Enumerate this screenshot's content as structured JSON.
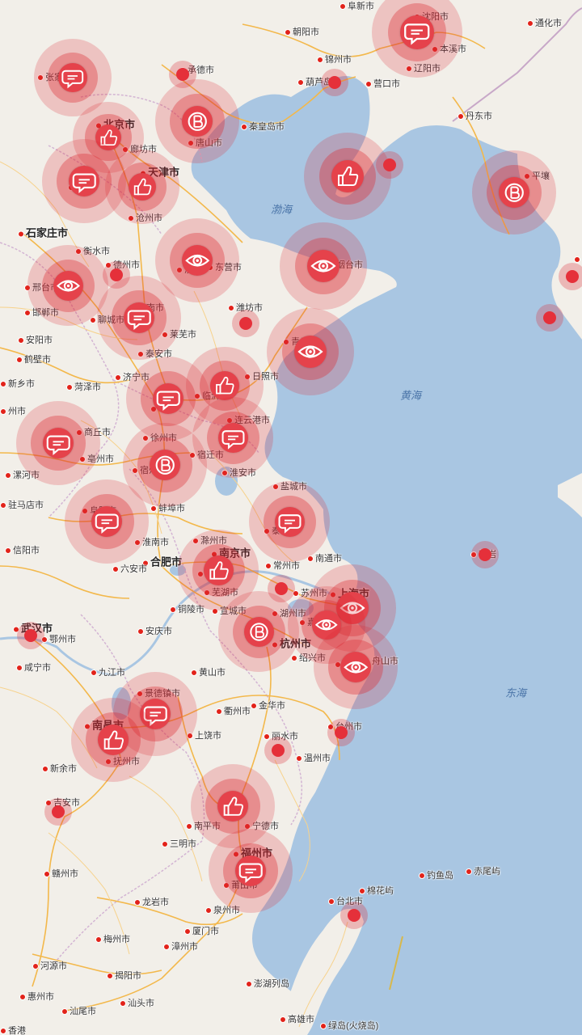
{
  "map": {
    "colors": {
      "land": "#f2efe9",
      "sea": "#a9c6e2",
      "road": "#f3b84b",
      "border": "#c8a8c8",
      "marker": "#e5424b"
    },
    "seas": [
      {
        "name": "渤海"
      },
      {
        "name": "黄海"
      },
      {
        "name": "东海"
      }
    ],
    "cities": [
      {
        "name": "张家口",
        "major": false
      },
      {
        "name": "承德市",
        "major": false
      },
      {
        "name": "朝阳市",
        "major": false
      },
      {
        "name": "阜新市",
        "major": false
      },
      {
        "name": "沈阳市",
        "major": false
      },
      {
        "name": "本溪市",
        "major": false
      },
      {
        "name": "辽阳市",
        "major": false
      },
      {
        "name": "锦州市",
        "major": false
      },
      {
        "name": "葫芦岛",
        "major": false
      },
      {
        "name": "营口市",
        "major": false
      },
      {
        "name": "通化市",
        "major": false
      },
      {
        "name": "丹东市",
        "major": false
      },
      {
        "name": "北京市",
        "major": true
      },
      {
        "name": "廊坊市",
        "major": false
      },
      {
        "name": "唐山市",
        "major": false
      },
      {
        "name": "秦皇岛市",
        "major": false
      },
      {
        "name": "天津市",
        "major": true
      },
      {
        "name": "保",
        "major": false
      },
      {
        "name": "沧州市",
        "major": false
      },
      {
        "name": "平壤",
        "major": false
      },
      {
        "name": "首",
        "major": false
      },
      {
        "name": "石家庄市",
        "major": true
      },
      {
        "name": "衡水市",
        "major": false
      },
      {
        "name": "德州市",
        "major": false
      },
      {
        "name": "滨州",
        "major": false
      },
      {
        "name": "东营市",
        "major": false
      },
      {
        "name": "烟台市",
        "major": false
      },
      {
        "name": "邢台市",
        "major": false
      },
      {
        "name": "邯郸市",
        "major": false
      },
      {
        "name": "聊城市",
        "major": false
      },
      {
        "name": "济南市",
        "major": false
      },
      {
        "name": "潍坊市",
        "major": false
      },
      {
        "name": "莱芜市",
        "major": false
      },
      {
        "name": "泰安市",
        "major": false
      },
      {
        "name": "青岛市",
        "major": false
      },
      {
        "name": "安阳市",
        "major": false
      },
      {
        "name": "鹤壁市",
        "major": false
      },
      {
        "name": "新乡市",
        "major": false
      },
      {
        "name": "济宁市",
        "major": false
      },
      {
        "name": "菏泽市",
        "major": false
      },
      {
        "name": "临沂市",
        "major": false
      },
      {
        "name": "日照市",
        "major": false
      },
      {
        "name": "枣",
        "major": false
      },
      {
        "name": "州市",
        "major": false
      },
      {
        "name": "商丘市",
        "major": false
      },
      {
        "name": "连云港市",
        "major": false
      },
      {
        "name": "徐州市",
        "major": false
      },
      {
        "name": "亳州市",
        "major": false
      },
      {
        "name": "宿州",
        "major": false
      },
      {
        "name": "宿迁市",
        "major": false
      },
      {
        "name": "淮安市",
        "major": false
      },
      {
        "name": "漯河市",
        "major": false
      },
      {
        "name": "驻马店市",
        "major": false
      },
      {
        "name": "阜阳市",
        "major": false
      },
      {
        "name": "蚌埠市",
        "major": false
      },
      {
        "name": "盐城市",
        "major": false
      },
      {
        "name": "淮南市",
        "major": false
      },
      {
        "name": "泰州",
        "major": false
      },
      {
        "name": "信阳市",
        "major": false
      },
      {
        "name": "滁州市",
        "major": false
      },
      {
        "name": "合肥市",
        "major": true
      },
      {
        "name": "六安市",
        "major": false
      },
      {
        "name": "南京市",
        "major": true
      },
      {
        "name": "常州市",
        "major": false
      },
      {
        "name": "南通市",
        "major": false
      },
      {
        "name": "马",
        "major": false
      },
      {
        "name": "芜湖市",
        "major": false
      },
      {
        "name": "苏州市",
        "major": false
      },
      {
        "name": "上海市",
        "major": true
      },
      {
        "name": "苏岩",
        "major": false
      },
      {
        "name": "铜陵市",
        "major": false
      },
      {
        "name": "宣城市",
        "major": false
      },
      {
        "name": "湖州市",
        "major": false
      },
      {
        "name": "嘉兴",
        "major": false
      },
      {
        "name": "武汉市",
        "major": true
      },
      {
        "name": "鄂州市",
        "major": false
      },
      {
        "name": "安庆市",
        "major": false
      },
      {
        "name": "杭州市",
        "major": true
      },
      {
        "name": "绍兴市",
        "major": false
      },
      {
        "name": "宁",
        "major": false
      },
      {
        "name": "舟山市",
        "major": false
      },
      {
        "name": "咸宁市",
        "major": false
      },
      {
        "name": "九江市",
        "major": false
      },
      {
        "name": "黄山市",
        "major": false
      },
      {
        "name": "景德镇市",
        "major": false
      },
      {
        "name": "衢州市",
        "major": false
      },
      {
        "name": "金华市",
        "major": false
      },
      {
        "name": "南昌市",
        "major": true
      },
      {
        "name": "上饶市",
        "major": false
      },
      {
        "name": "台州市",
        "major": false
      },
      {
        "name": "抚州市",
        "major": false
      },
      {
        "name": "丽水市",
        "major": false
      },
      {
        "name": "新余市",
        "major": false
      },
      {
        "name": "温州市",
        "major": false
      },
      {
        "name": "吉安市",
        "major": false
      },
      {
        "name": "南平市",
        "major": false
      },
      {
        "name": "宁德市",
        "major": false
      },
      {
        "name": "三明市",
        "major": false
      },
      {
        "name": "福州市",
        "major": true
      },
      {
        "name": "赣州市",
        "major": false
      },
      {
        "name": "莆田市",
        "major": false
      },
      {
        "name": "钓鱼岛",
        "major": false
      },
      {
        "name": "赤尾屿",
        "major": false
      },
      {
        "name": "棉花屿",
        "major": false
      },
      {
        "name": "龙岩市",
        "major": false
      },
      {
        "name": "泉州市",
        "major": false
      },
      {
        "name": "台北市",
        "major": false
      },
      {
        "name": "梅州市",
        "major": false
      },
      {
        "name": "厦门市",
        "major": false
      },
      {
        "name": "漳州市",
        "major": false
      },
      {
        "name": "河源市",
        "major": false
      },
      {
        "name": "揭阳市",
        "major": false
      },
      {
        "name": "澎湖列岛",
        "major": false
      },
      {
        "name": "惠州市",
        "major": false
      },
      {
        "name": "汕头市",
        "major": false
      },
      {
        "name": "汕尾市",
        "major": false
      },
      {
        "name": "香港",
        "major": false
      },
      {
        "name": "高雄市",
        "major": false
      },
      {
        "name": "绿岛(火烧岛)",
        "major": false
      }
    ],
    "markers": [
      {
        "icon": "chat"
      },
      {
        "icon": "chat"
      },
      {
        "icon": "b"
      },
      {
        "icon": "like"
      },
      {
        "icon": "chat"
      },
      {
        "icon": "like"
      },
      {
        "icon": "like"
      },
      {
        "icon": "b"
      },
      {
        "icon": "eye"
      },
      {
        "icon": "eye"
      },
      {
        "icon": "eye"
      },
      {
        "icon": "chat"
      },
      {
        "icon": "eye"
      },
      {
        "icon": "like"
      },
      {
        "icon": "chat"
      },
      {
        "icon": "chat"
      },
      {
        "icon": "chat"
      },
      {
        "icon": "b"
      },
      {
        "icon": "chat"
      },
      {
        "icon": "chat"
      },
      {
        "icon": "like"
      },
      {
        "icon": "eye"
      },
      {
        "icon": "eye"
      },
      {
        "icon": "b"
      },
      {
        "icon": "eye"
      },
      {
        "icon": "chat"
      },
      {
        "icon": "like"
      },
      {
        "icon": "like"
      },
      {
        "icon": "chat"
      }
    ]
  }
}
